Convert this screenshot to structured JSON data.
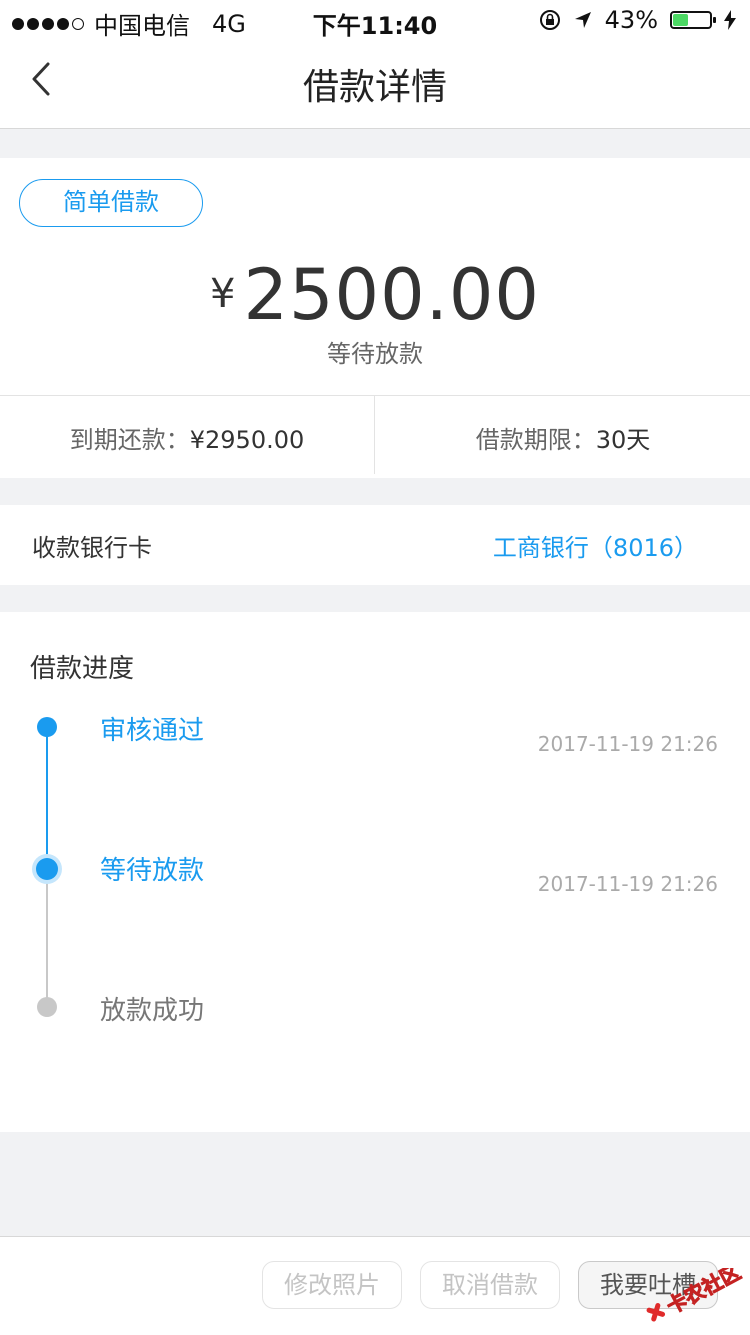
{
  "status_bar": {
    "carrier": "中国电信",
    "network": "4G",
    "time": "下午11:40",
    "battery_percent": "43%",
    "battery_level": 0.43
  },
  "nav": {
    "title": "借款详情"
  },
  "loan": {
    "type_label": "简单借款",
    "currency_symbol": "¥",
    "amount": "2500.00",
    "status": "等待放款",
    "due_label": "到期还款：",
    "due_value": "¥2950.00",
    "term_label": "借款期限：",
    "term_value": "30天"
  },
  "bank": {
    "label": "收款银行卡",
    "value": "工商银行（8016）"
  },
  "progress": {
    "title": "借款进度",
    "steps": [
      {
        "label": "审核通过",
        "time": "2017-11-19 21:26",
        "state": "done"
      },
      {
        "label": "等待放款",
        "time": "2017-11-19 21:26",
        "state": "current"
      },
      {
        "label": "放款成功",
        "time": "",
        "state": "pending"
      }
    ]
  },
  "actions": {
    "modify_photo": "修改照片",
    "cancel_loan": "取消借款",
    "complain": "我要吐槽"
  },
  "watermark": {
    "text": "卡农社区"
  },
  "colors": {
    "accent": "#1a9bef",
    "background": "#f1f2f4",
    "muted": "#c8c8c8"
  }
}
